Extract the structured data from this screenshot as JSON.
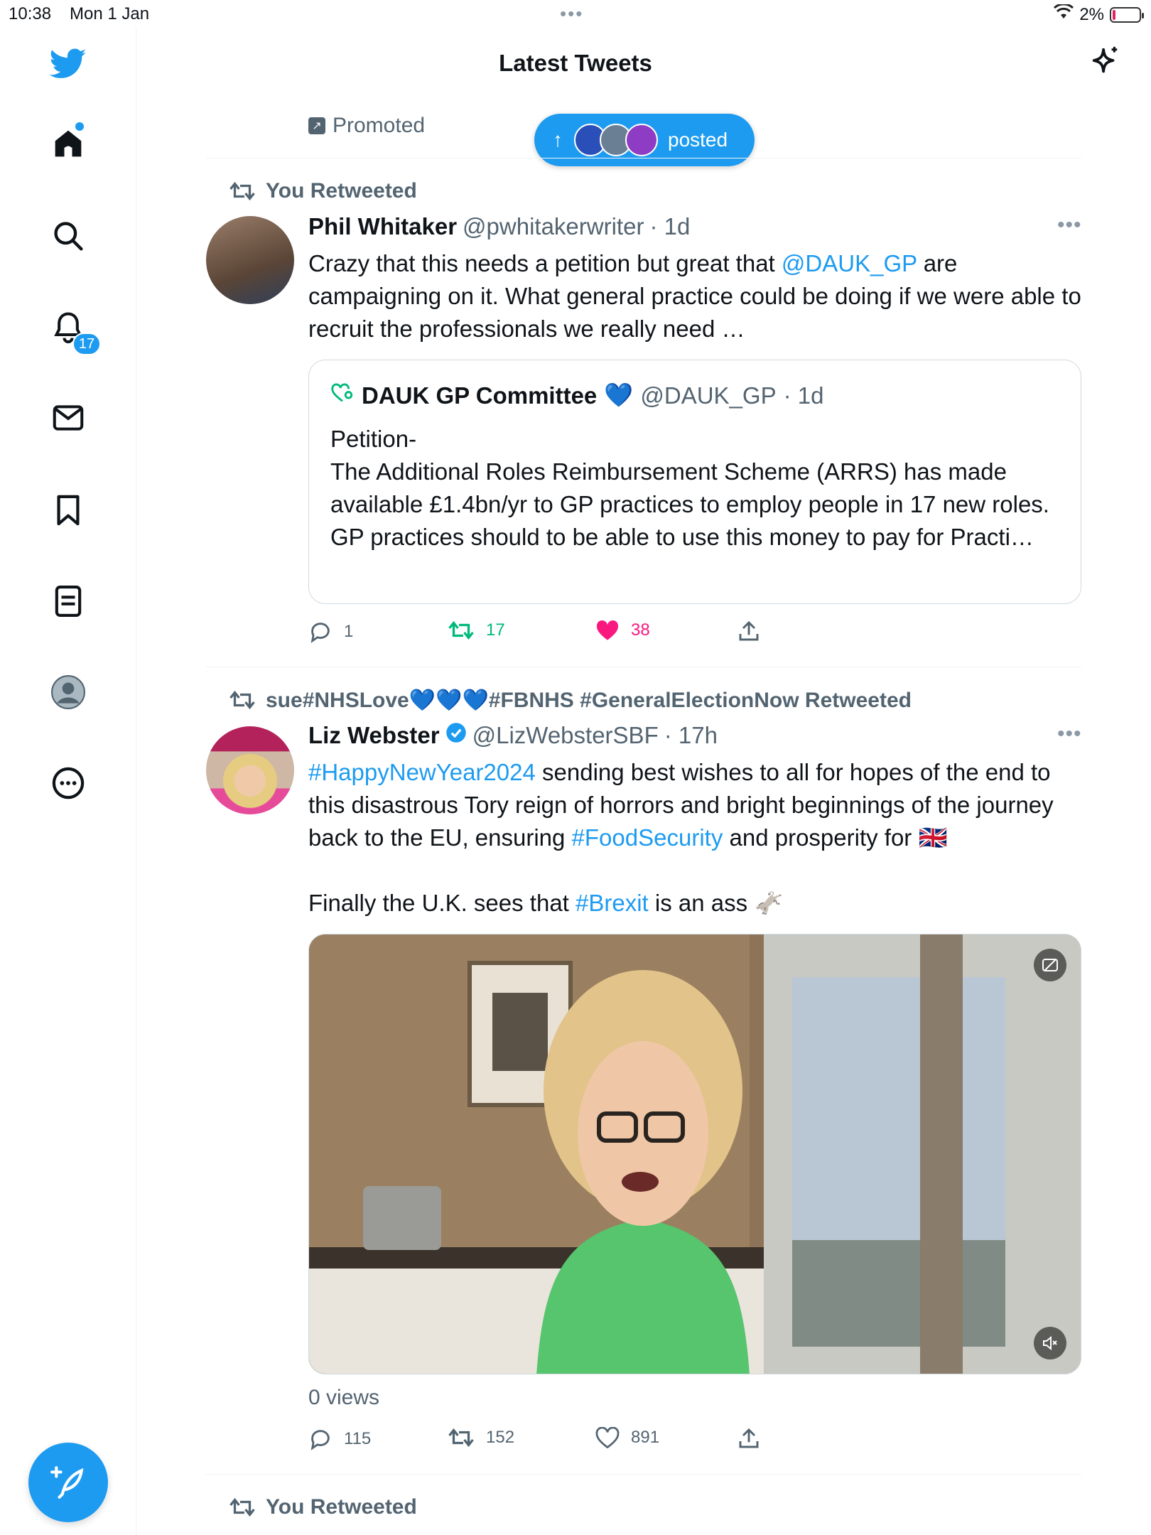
{
  "status_bar": {
    "time": "10:38",
    "date": "Mon 1 Jan",
    "battery": "2%"
  },
  "sidebar": {
    "items": [
      {
        "name": "home"
      },
      {
        "name": "explore"
      },
      {
        "name": "notifications"
      },
      {
        "name": "messages"
      },
      {
        "name": "bookmarks"
      },
      {
        "name": "lists"
      },
      {
        "name": "profile"
      },
      {
        "name": "more"
      }
    ],
    "notifications_badge": "17"
  },
  "header": {
    "title": "Latest Tweets"
  },
  "promoted": {
    "label": "Promoted"
  },
  "new_posts_pill": {
    "label": "posted"
  },
  "tweets": [
    {
      "social_context": "You Retweeted",
      "name": "Phil Whitaker",
      "handle": "@pwhitakerwriter",
      "time": "· 1d",
      "text_before": "Crazy that this needs a petition but great that ",
      "mention": "@DAUK_GP",
      "text_after": " are campaigning on it. What general practice could be doing if we were able to recruit the professionals we really need …",
      "quote": {
        "name": "DAUK GP Committee",
        "emoji": "💙",
        "handle": "@DAUK_GP",
        "time": "· 1d",
        "lines": [
          "Petition-",
          "The Additional Roles Reimbursement Scheme (ARRS) has made available £1.4bn/yr to GP practices to employ people in 17 new roles.",
          "GP practices should to be able to use this money to pay for Practi…"
        ]
      },
      "replies": "1",
      "retweets": "17",
      "likes": "38"
    },
    {
      "social_context": "sue#NHSLove💙💙💙#FBNHS #GeneralElectionNow Retweeted",
      "name": "Liz Webster",
      "handle": "@LizWebsterSBF",
      "time": "· 17h",
      "hashtag1": "#HappyNewYear2024",
      "text1": " sending best wishes to all for hopes of the end to this disastrous Tory reign of horrors and bright beginnings of the journey back to the EU, ensuring ",
      "hashtag2": "#FoodSecurity",
      "text2": " and prosperity for 🇬🇧",
      "text3": "Finally the U.K. sees that ",
      "hashtag3": "#Brexit",
      "text4": " is an ass 🫏",
      "views": "0 views",
      "replies": "115",
      "retweets": "152",
      "likes": "891"
    },
    {
      "social_context": "You Retweeted"
    }
  ],
  "colors": {
    "accent": "#1d9bf0",
    "retweet": "#00ba7c",
    "like": "#f91880",
    "muted": "#536471"
  }
}
